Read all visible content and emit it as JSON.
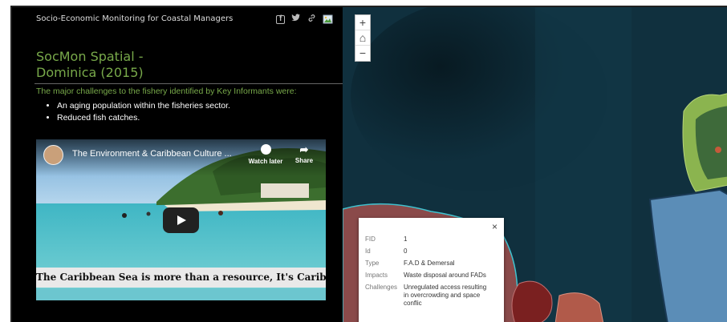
{
  "header": {
    "title": "Socio-Economic Monitoring for Coastal Managers",
    "icons": [
      "facebook-icon",
      "twitter-icon",
      "link-icon",
      "image-icon"
    ]
  },
  "app": {
    "title_line1": "SocMon Spatial -",
    "title_line2": "Dominica (2015)"
  },
  "story": {
    "lead": "The major challenges to the fishery identified by Key Informants were:",
    "bullets": [
      "An aging population within the fisheries sector.",
      "Reduced fish catches."
    ]
  },
  "video": {
    "title": "The Environment & Caribbean Culture ...",
    "watch_later": "Watch later",
    "share": "Share",
    "caption": "The Caribbean Sea is more than a resource, It's  Caribbean Life"
  },
  "map": {
    "zoom_in": "+",
    "home": "⌂",
    "zoom_out": "−"
  },
  "popup": {
    "close": "×",
    "rows": [
      {
        "key": "FID",
        "value": "1"
      },
      {
        "key": "Id",
        "value": "0"
      },
      {
        "key": "Type",
        "value": "F.A.D & Demersal"
      },
      {
        "key": "Impacts",
        "value": "Waste disposal around FADs"
      },
      {
        "key": "Challenges",
        "value": "Unregulated access resulting in overcrowding and space conflic"
      }
    ]
  },
  "colors": {
    "accent_green": "#78a94a",
    "panel_bg": "#000000",
    "map_sea": "#0e2c39",
    "zone_fill": "#8a4a4a"
  }
}
